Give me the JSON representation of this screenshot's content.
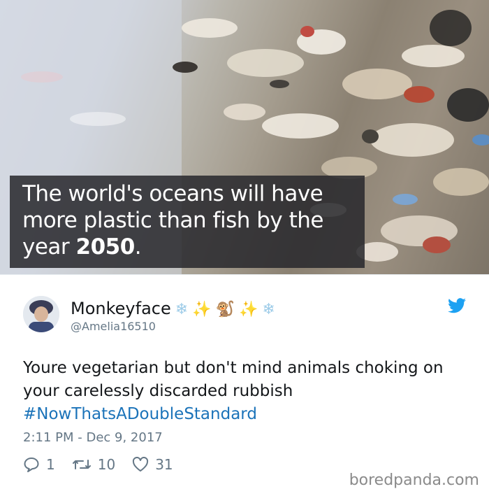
{
  "image": {
    "caption_line1": "The world's oceans will have",
    "caption_line2": "more plastic than fish by the",
    "caption_line3_prefix": "year ",
    "caption_year": "2050",
    "caption_line3_suffix": "."
  },
  "tweet": {
    "display_name": "Monkeyface",
    "name_emoji": [
      "❄",
      "✨",
      "🐒",
      "✨",
      "❄"
    ],
    "handle": "@Amelia16510",
    "text_line1": "Youre vegetarian but don't mind animals choking on",
    "text_line2": "your carelessly discarded rubbish",
    "hashtag": "#NowThatsADoubleStandard",
    "timestamp": "2:11 PM - Dec 9, 2017",
    "replies": "1",
    "retweets": "10",
    "likes": "31"
  },
  "colors": {
    "hashtag": "#1b73b9",
    "twitter_blue": "#1da1f2",
    "meta_gray": "#657786"
  },
  "watermark": "boredpanda.com"
}
